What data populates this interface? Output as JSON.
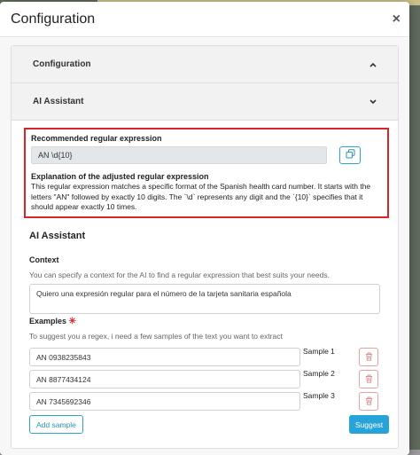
{
  "modal": {
    "title": "Configuration",
    "close_icon": "×"
  },
  "accordion": {
    "panels": [
      {
        "label": "Configuration",
        "chevron": "chevron-up-icon",
        "expanded": false
      },
      {
        "label": "AI Assistant",
        "chevron": "chevron-down-icon",
        "expanded": true
      }
    ]
  },
  "recommended": {
    "label": "Recommended regular expression",
    "value": "AN \\d{10}",
    "copy_icon": "copy-icon",
    "explanation_title": "Explanation of the adjusted regular expression",
    "explanation_text": "This regular expression matches a specific format of the Spanish health card number. It starts with the letters \"AN\" followed by exactly 10 digits. The `\\d` represents any digit and the `{10}` specifies that it should appear exactly 10 times."
  },
  "assistant": {
    "heading": "AI Assistant",
    "context_label": "Context",
    "context_help": "You can specify a context for the AI to find a regular expression that best suits your needs.",
    "context_value": "Quiero una expresión regular para el número de la tarjeta sanitaria española",
    "examples_label": "Examples",
    "required_mark": "✳",
    "examples_help": "To suggest you a regex, i need a few samples of the text you want to extract",
    "samples": [
      {
        "value": "AN 0938235843",
        "label": "Sample 1"
      },
      {
        "value": "AN 8877434124",
        "label": "Sample 2"
      },
      {
        "value": "AN 7345692346",
        "label": "Sample 3"
      }
    ],
    "add_sample_label": "Add sample",
    "suggest_label": "Suggest"
  },
  "colors": {
    "accent": "#27a3d8",
    "highlight_border": "#d9242a",
    "danger": "#e0262b"
  }
}
